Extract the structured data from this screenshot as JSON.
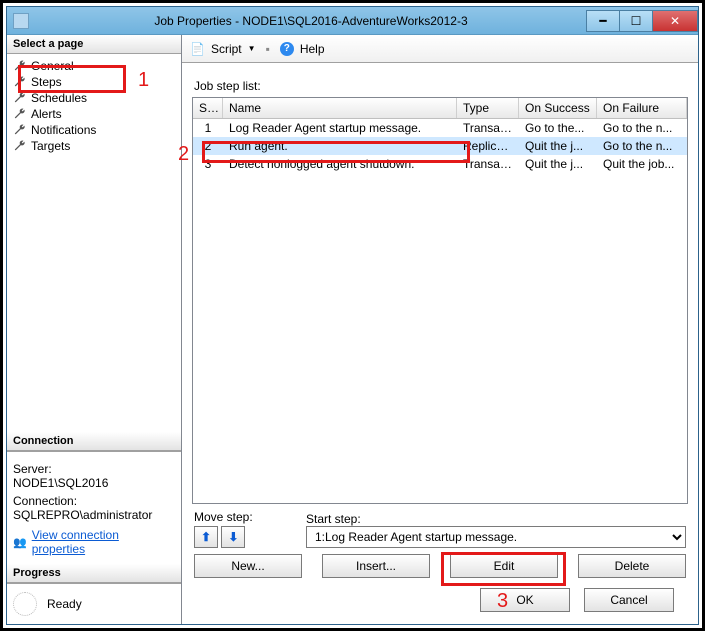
{
  "window": {
    "title": "Job Properties - NODE1\\SQL2016-AdventureWorks2012-3"
  },
  "pages": {
    "header": "Select a page",
    "items": [
      {
        "label": "General"
      },
      {
        "label": "Steps"
      },
      {
        "label": "Schedules"
      },
      {
        "label": "Alerts"
      },
      {
        "label": "Notifications"
      },
      {
        "label": "Targets"
      }
    ]
  },
  "connection": {
    "header": "Connection",
    "server_lbl": "Server:",
    "server_val": "NODE1\\SQL2016",
    "conn_lbl": "Connection:",
    "conn_val": "SQLREPRO\\administrator",
    "view_props": "View connection properties"
  },
  "progress": {
    "header": "Progress",
    "status": "Ready"
  },
  "toolbar": {
    "script": "Script",
    "help": "Help"
  },
  "steps": {
    "list_label": "Job step list:",
    "columns": {
      "st": "St...",
      "name": "Name",
      "type": "Type",
      "success": "On Success",
      "failure": "On Failure"
    },
    "rows": [
      {
        "st": "1",
        "name": "Log Reader Agent startup message.",
        "type": "Transact-...",
        "success": "Go to the...",
        "failure": "Go to the n..."
      },
      {
        "st": "2",
        "name": "Run agent.",
        "type": "Replicati...",
        "success": "Quit the j...",
        "failure": "Go to the n..."
      },
      {
        "st": "3",
        "name": "Detect nonlogged agent shutdown.",
        "type": "Transact-...",
        "success": "Quit the j...",
        "failure": "Quit the job..."
      }
    ],
    "selected_index": 1,
    "move_label": "Move step:",
    "start_label": "Start step:",
    "start_value": "1:Log Reader Agent startup message."
  },
  "buttons": {
    "new": "New...",
    "insert": "Insert...",
    "edit": "Edit",
    "delete": "Delete",
    "ok": "OK",
    "cancel": "Cancel"
  },
  "annotations": {
    "n1": "1",
    "n2": "2",
    "n3": "3"
  }
}
